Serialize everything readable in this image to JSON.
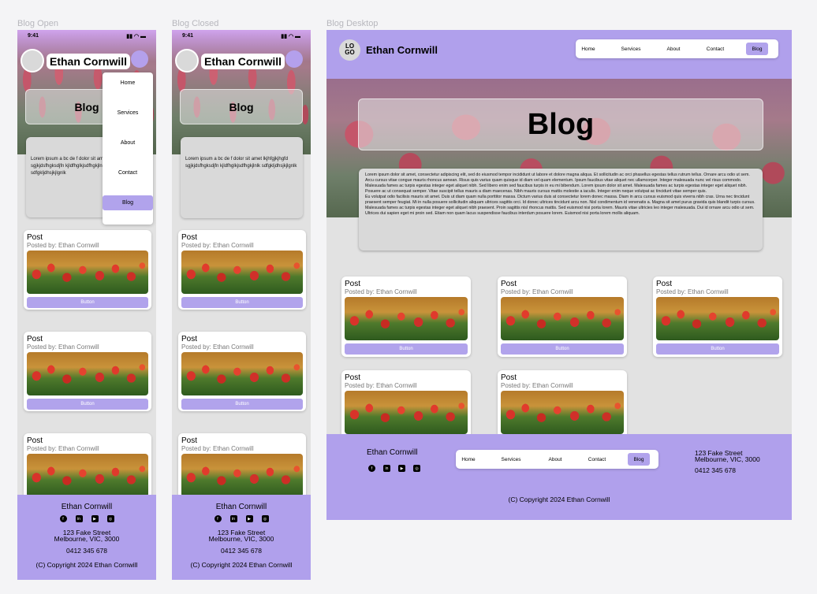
{
  "frames": {
    "open_label": "Blog Open",
    "closed_label": "Blog Closed",
    "desktop_label": "Blog Desktop"
  },
  "mobile": {
    "time": "9:41",
    "status_icons": "▮▮ ◠ ▬",
    "name": "Ethan Cornwill",
    "blog_title": "Blog",
    "lorem_open": "Lorem ipsum a bc de f dolor sit amet lkjhfgjkjhgfd sgjkjdsfhgksdjfn kjldfhglkjsdfhgkjlnlk sdfgkljdhsjkjlgnlk",
    "lorem_closed": "Lorem ipsum a bc de f dolor sit amet lkjhfgjkjhgfd sgjkjdsfhgksdjfn kjldfhglkjsdfhgkjlnlk sdfgkljdhsjkjlgnlk",
    "menu": [
      "Home",
      "Services",
      "About",
      "Contact",
      "Blog"
    ],
    "post_title": "Post",
    "posted_by": "Posted by: Ethan Cornwill",
    "button_label": "Button"
  },
  "footer": {
    "name": "Ethan Cornwill",
    "address_line1": "123 Fake Street",
    "address_line2": "Melbourne, VIC, 3000",
    "phone": "0412 345 678",
    "copyright": "(C) Copyright 2024 Ethan Cornwill",
    "social_icons": [
      "facebook-icon",
      "linkedin-icon",
      "youtube-icon",
      "instagram-icon"
    ]
  },
  "desktop": {
    "logo_line1": "LO",
    "logo_line2": "GO",
    "name": "Ethan Cornwill",
    "nav": [
      "Home",
      "Services",
      "About",
      "Contact",
      "Blog"
    ],
    "blog_title": "Blog",
    "lorem": "Lorem ipsum dolor sit amet, consectetur adipiscing elit, sed do eiusmod tempor incididunt ut labore et dolore magna aliqua. Et sollicitudin ac orci phasellus egestas tellus rutrum tellus. Ornare arcu odio ut sem. Arcu cursus vitae congue mauris rhoncus aenean. Risus quis varius quam quisque id diam vel quam elementum. Ipsum faucibus vitae aliquet nec ullamcorper. Integer malesuada nunc vel risus commodo. Malesuada fames ac turpis egestas integer eget aliquet nibh. Sed libero enim sed faucibus turpis in eu mi bibendum. Lorem ipsum dolor sit amet. Malesuada fames ac turpis egestas integer eget aliquet nibh. Posuere ac ut consequat semper. Vitae suscipit tellus mauris a diam maecenas. Nibh mauris cursus mattis molestie a iaculis. Integer enim neque volutpat ac tincidunt vitae semper quis.",
    "lorem2": "Eu volutpat odio facilisis mauris sit amet. Duis ut diam quam nulla porttitor massa. Dictum varius duis at consectetur lorem donec massa. Diam in arcu cursus euismod quis viverra nibh cras. Urna nec tincidunt praesent semper feugiat. Mi in nulla posuere sollicitudin aliquam ultrices sagittis orci. Id donec ultrices tincidunt arcu non. Nisl condimentum id venenatis a. Magna sit amet purus gravida quis blandit turpis cursus. Malesuada fames ac turpis egestas integer eget aliquet nibh praesent. Proin sagittis nisl rhoncus mattis. Sed euismod nisi porta lorem. Mauris vitae ultricies leo integer malesuada. Dui id ornare arcu odio ut sem. Ultrices dui sapien eget mi proin sed. Etiam non quam lacus suspendisse faucibus interdum posuere lorem. Euismod nisi porta lorem mollis aliquam."
  }
}
